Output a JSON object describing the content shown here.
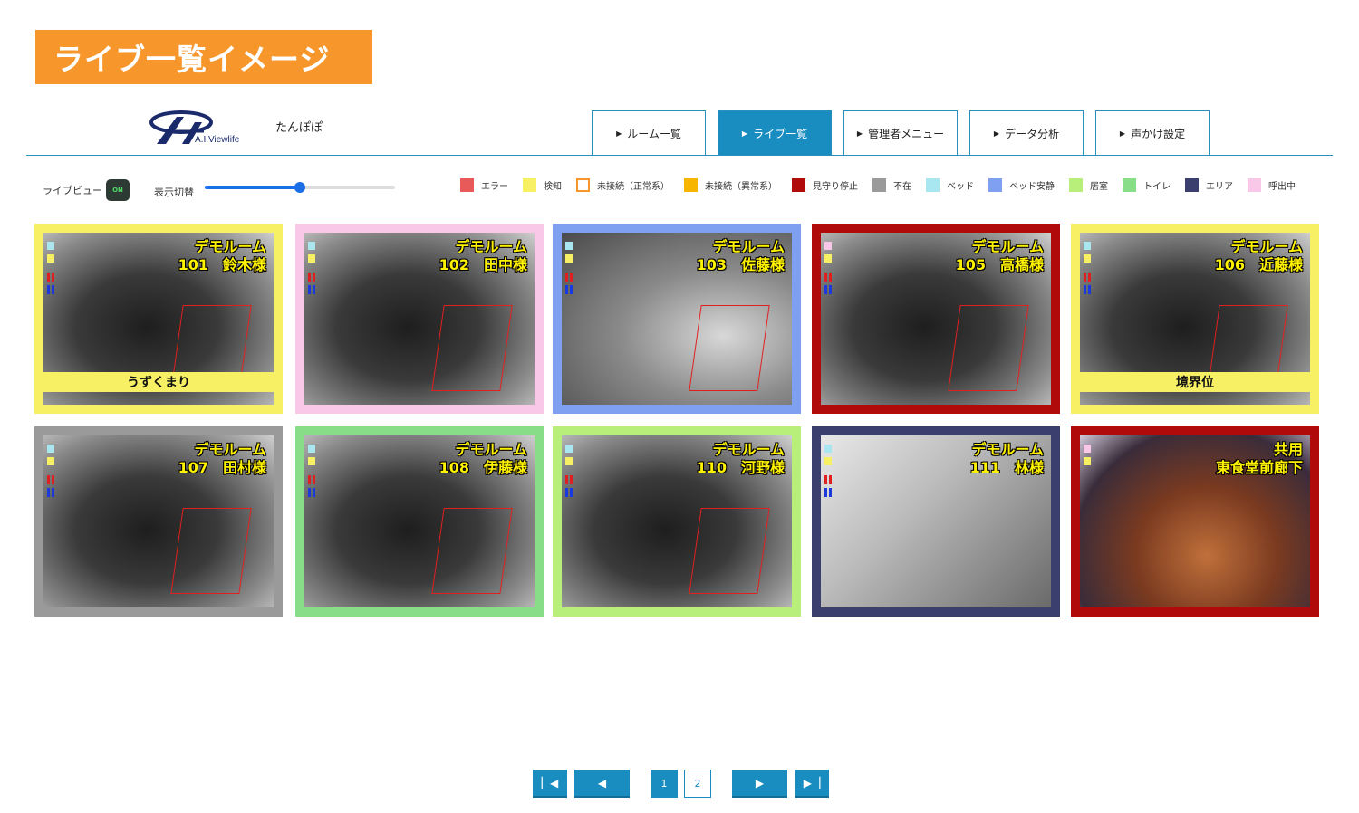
{
  "banner": {
    "title": "ライブ一覧イメージ"
  },
  "header": {
    "logo_text": "A.I.Viewlife",
    "facility_name": "たんぽぽ",
    "tabs": [
      {
        "label": "ルーム一覧",
        "active": false
      },
      {
        "label": "ライブ一覧",
        "active": true
      },
      {
        "label": "管理者メニュー",
        "active": false
      },
      {
        "label": "データ分析",
        "active": false
      },
      {
        "label": "声かけ設定",
        "active": false
      }
    ]
  },
  "controls": {
    "live_view_label": "ライブビュー",
    "live_view_toggle": "ON",
    "display_switch_label": "表示切替",
    "display_slider_value": 0.5
  },
  "legend": [
    {
      "label": "エラー",
      "color": "#e85a5a",
      "outline": false
    },
    {
      "label": "検知",
      "color": "#f8f064",
      "outline": false
    },
    {
      "label": "未接続（正常系）",
      "color": "#f7962a",
      "outline": true
    },
    {
      "label": "未接続（異常系）",
      "color": "#f7b500",
      "outline": false
    },
    {
      "label": "見守り停止",
      "color": "#b00a0a",
      "outline": false
    },
    {
      "label": "不在",
      "color": "#9a9a9a",
      "outline": false
    },
    {
      "label": "ベッド",
      "color": "#a8e6f0",
      "outline": false
    },
    {
      "label": "ベッド安静",
      "color": "#7f9ff0",
      "outline": false
    },
    {
      "label": "居室",
      "color": "#b8ee7a",
      "outline": false
    },
    {
      "label": "トイレ",
      "color": "#88dd88",
      "outline": false
    },
    {
      "label": "エリア",
      "color": "#3a3f6e",
      "outline": false
    },
    {
      "label": "呼出中",
      "color": "#f9c8e8",
      "outline": false
    }
  ],
  "tiles": [
    {
      "line1": "デモルーム",
      "line2": "101　鈴木様",
      "border": "#f8f064",
      "status": "うずくまり",
      "scene": "dark"
    },
    {
      "line1": "デモルーム",
      "line2": "102　田中様",
      "border": "#f9c8e8",
      "status": "",
      "scene": "dark"
    },
    {
      "line1": "デモルーム",
      "line2": "103　佐藤様",
      "border": "#7f9ff0",
      "status": "",
      "scene": "room"
    },
    {
      "line1": "デモルーム",
      "line2": "105　高橋様",
      "border": "#b00a0a",
      "status": "",
      "scene": "dark"
    },
    {
      "line1": "デモルーム",
      "line2": "106　近藤様",
      "border": "#f8f064",
      "status": "境界位",
      "scene": "dark"
    },
    {
      "line1": "デモルーム",
      "line2": "107　田村様",
      "border": "#9a9a9a",
      "status": "",
      "scene": "dark"
    },
    {
      "line1": "デモルーム",
      "line2": "108　伊藤様",
      "border": "#88dd88",
      "status": "",
      "scene": "dark"
    },
    {
      "line1": "デモルーム",
      "line2": "110　河野様",
      "border": "#b8ee7a",
      "status": "",
      "scene": "dark"
    },
    {
      "line1": "デモルーム",
      "line2": "111　林様",
      "border": "#3a3f6e",
      "status": "",
      "scene": "area"
    },
    {
      "line1": "共用",
      "line2": "東食堂前廊下",
      "border": "#b00a0a",
      "status": "",
      "scene": "color"
    }
  ],
  "pagination": {
    "first_icon": "first-page-icon",
    "prev_icon": "prev-page-icon",
    "next_icon": "next-page-icon",
    "last_icon": "last-page-icon",
    "pages": [
      "1",
      "2"
    ],
    "current": "1"
  }
}
